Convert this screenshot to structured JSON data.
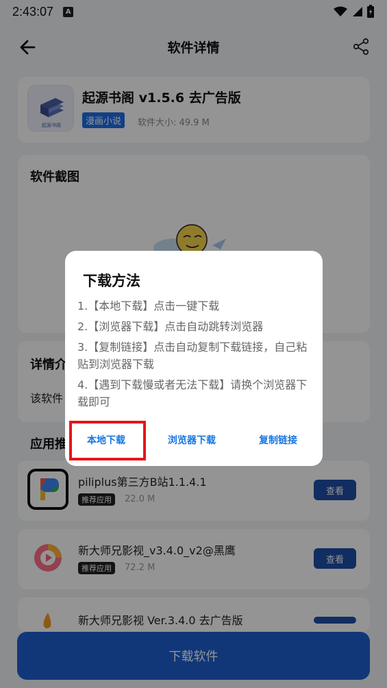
{
  "status": {
    "time": "2:43:07"
  },
  "header": {
    "title": "软件详情"
  },
  "app": {
    "name": "起源书阁 v1.5.6 去广告版",
    "category": "漫画小说",
    "size": "软件大小: 49.9 M",
    "icon_label": "起源书阁"
  },
  "screenshots": {
    "title": "软件截图"
  },
  "details": {
    "title": "详情介",
    "text": "该软件"
  },
  "recommend": {
    "title": "应用推",
    "items": [
      {
        "name": "piliplus第三方B站1.1.4.1",
        "badge": "推荐应用",
        "size": "22.0 M",
        "button": "查看"
      },
      {
        "name": "新大师兄影视_v3.4.0_v2@黑鹰",
        "badge": "推荐应用",
        "size": "72.2 M",
        "button": "查看"
      },
      {
        "name": "新大师兄影视 Ver.3.4.0 去广告版"
      }
    ]
  },
  "download_button": "下载软件",
  "dialog": {
    "title": "下载方法",
    "lines": [
      "1.【本地下载】点击一键下载",
      "2.【浏览器下载】点击自动跳转浏览器",
      "3.【复制链接】点击自动复制下载链接，自己粘贴到浏览器下载",
      "4.【遇到下载慢或者无法下载】请换个浏览器下载即可"
    ],
    "buttons": {
      "local": "本地下载",
      "browser": "浏览器下载",
      "copy": "复制链接"
    }
  },
  "colors": {
    "accent": "#1e5fd1",
    "dialog_button": "#1976e0",
    "highlight": "#e8141b"
  }
}
